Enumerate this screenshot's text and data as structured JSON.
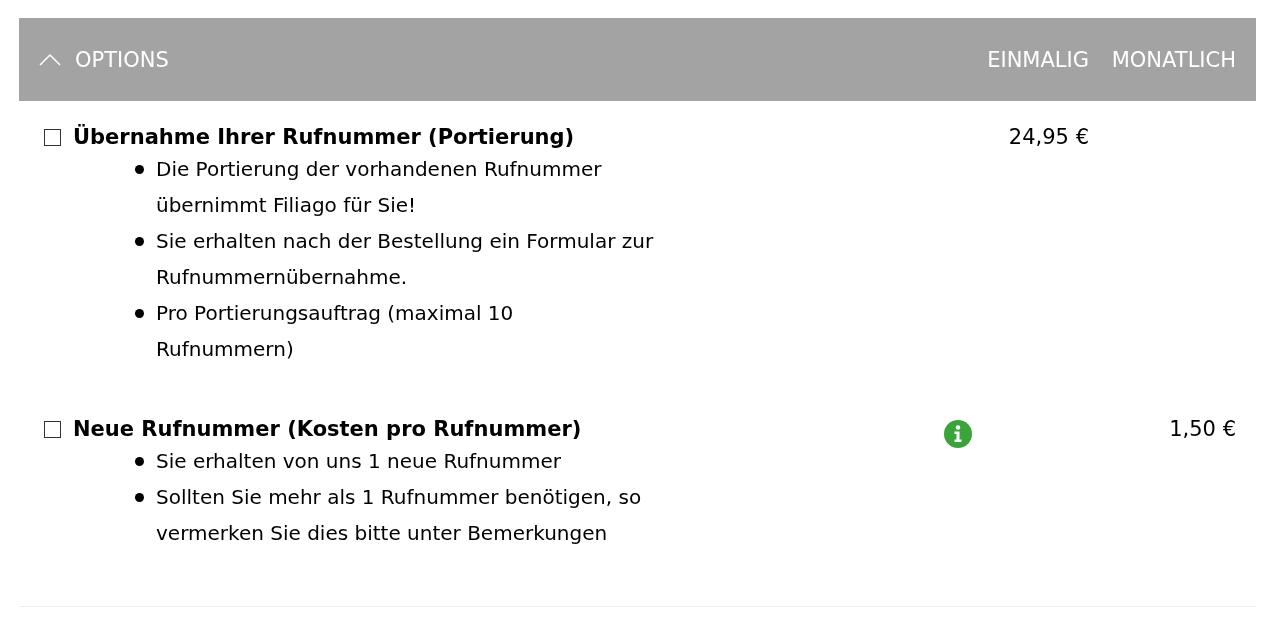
{
  "header": {
    "title": "OPTIONS",
    "expanded": true,
    "columns": [
      "EINMALIG",
      "MONATLICH"
    ]
  },
  "options": [
    {
      "checked": false,
      "title": "Übernahme Ihrer Rufnummer (Portierung)",
      "info": false,
      "once": "24,95 €",
      "bullets": [
        "Die Portierung der vorhandenen Rufnummer übernimmt Filiago für Sie!",
        "Sie erhalten nach der Bestellung ein Formular zur Rufnummernübernahme.",
        "Pro Portierungsauftrag (maximal 10 Rufnummern)"
      ]
    },
    {
      "checked": false,
      "title": "Neue Rufnummer (Kosten pro Rufnummer)",
      "info": true,
      "monthly": "1,50 €",
      "bullets": [
        "Sie erhalten von uns 1 neue Rufnummer",
        "Sollten Sie mehr als 1 Rufnummer benötigen, so vermerken Sie dies bitte unter Bemerkungen"
      ]
    }
  ]
}
